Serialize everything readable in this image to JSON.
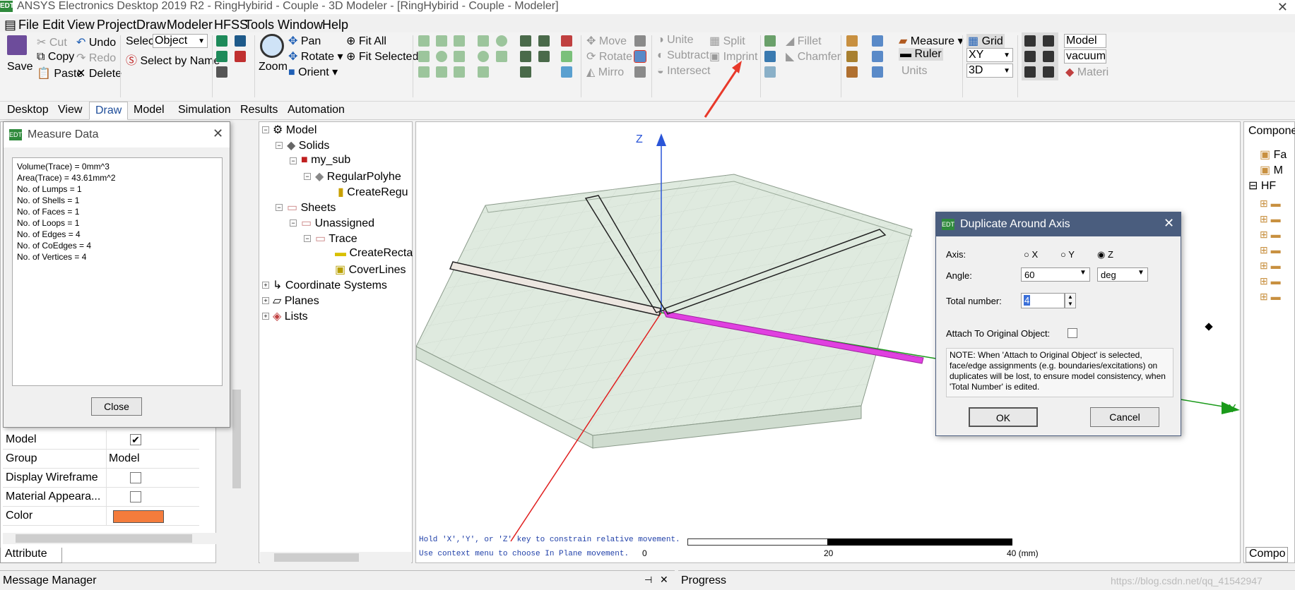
{
  "window": {
    "title": "ANSYS Electronics Desktop 2019 R2 - RingHybirid - Couple - 3D Modeler - [RingHybirid - Couple - Modeler]",
    "app_icon": "EDT"
  },
  "menu": [
    "File",
    "Edit",
    "View",
    "Project",
    "Draw",
    "Modeler",
    "HFSS",
    "Tools",
    "Window",
    "Help"
  ],
  "ribbon": {
    "save": "Save",
    "cut": "Cut",
    "copy": "Copy",
    "paste": "Paste",
    "undo": "Undo",
    "redo": "Redo",
    "delete": "Delete",
    "select_label": "Select:",
    "select_value": "Object",
    "select_by_name": "Select by Name",
    "zoom": "Zoom",
    "pan": "Pan",
    "rotate": "Rotate",
    "orient": "Orient",
    "fit_all": "Fit All",
    "fit_selected": "Fit Selected",
    "move": "Move",
    "rotate2": "Rotate",
    "mirror": "Mirro",
    "unite": "Unite",
    "subtract": "Subtract",
    "intersect": "Intersect",
    "split": "Split",
    "imprint": "Imprint",
    "fillet": "Fillet",
    "chamfer": "Chamfer",
    "measure": "Measure",
    "ruler": "Ruler",
    "units": "Units",
    "grid": "Grid",
    "plane": "XY",
    "dim": "3D",
    "model": "Model",
    "material": "vacuum",
    "materials_link": "Materi"
  },
  "tabs": [
    "Desktop",
    "View",
    "Draw",
    "Model",
    "Simulation",
    "Results",
    "Automation"
  ],
  "measure_dialog": {
    "title": "Measure Data",
    "lines": [
      "Volume(Trace) = 0mm^3",
      "Area(Trace) = 43.61mm^2",
      "No. of Lumps = 1",
      "No. of Shells = 1",
      "No. of Faces = 1",
      "No. of Loops = 1",
      "No. of Edges = 4",
      "No. of CoEdges = 4",
      "No. of Vertices = 4"
    ],
    "close": "Close"
  },
  "properties": {
    "rows": [
      {
        "name": "Model",
        "value": ""
      },
      {
        "name": "Group",
        "value": "Model"
      },
      {
        "name": "Display Wireframe",
        "value": ""
      },
      {
        "name": "Material Appeara...",
        "value": ""
      },
      {
        "name": "Color",
        "value": ""
      }
    ],
    "tab": "Attribute",
    "color_swatch": "#f47c3c"
  },
  "tree": {
    "model": "Model",
    "solids": "Solids",
    "my_sub": "my_sub",
    "polyhedron": "RegularPolyhe",
    "create_regular": "CreateRegu",
    "sheets": "Sheets",
    "unassigned": "Unassigned",
    "trace": "Trace",
    "create_rect": "CreateRecta",
    "cover_lines": "CoverLines",
    "coord_systems": "Coordinate Systems",
    "planes": "Planes",
    "lists": "Lists"
  },
  "viewport": {
    "axis_z": "Z",
    "axis_y": "Y",
    "hint1": "Hold 'X','Y', or 'Z' key to constrain relative movement.",
    "hint2": "Use context menu to choose In Plane movement.",
    "scale_labels": [
      "0",
      "20",
      "40 (mm)"
    ]
  },
  "dup_dialog": {
    "title": "Duplicate Around Axis",
    "axis_label": "Axis:",
    "axis_options": [
      "X",
      "Y",
      "Z"
    ],
    "axis_selected": "Z",
    "angle_label": "Angle:",
    "angle_value": "60",
    "angle_unit": "deg",
    "total_label": "Total number:",
    "total_value": "4",
    "attach_label": "Attach To Original Object:",
    "note": "NOTE:  When 'Attach to Original Object' is selected, face/edge assignments (e.g. boundaries/excitations) on duplicates will be lost, to ensure model consistency, when 'Total Number' is edited.",
    "ok": "OK",
    "cancel": "Cancel"
  },
  "right_panel": {
    "title": "Compone",
    "items": [
      "Fa",
      "M",
      "HF"
    ],
    "bottom_tab": "Compo"
  },
  "bottom": {
    "message_manager": "Message Manager",
    "progress": "Progress",
    "watermark": "https://blog.csdn.net/qq_41542947"
  },
  "colors": {
    "trace_fill": "#e040e0",
    "arrow": "#e8392a",
    "dialog_title": "#4a5d7e"
  }
}
